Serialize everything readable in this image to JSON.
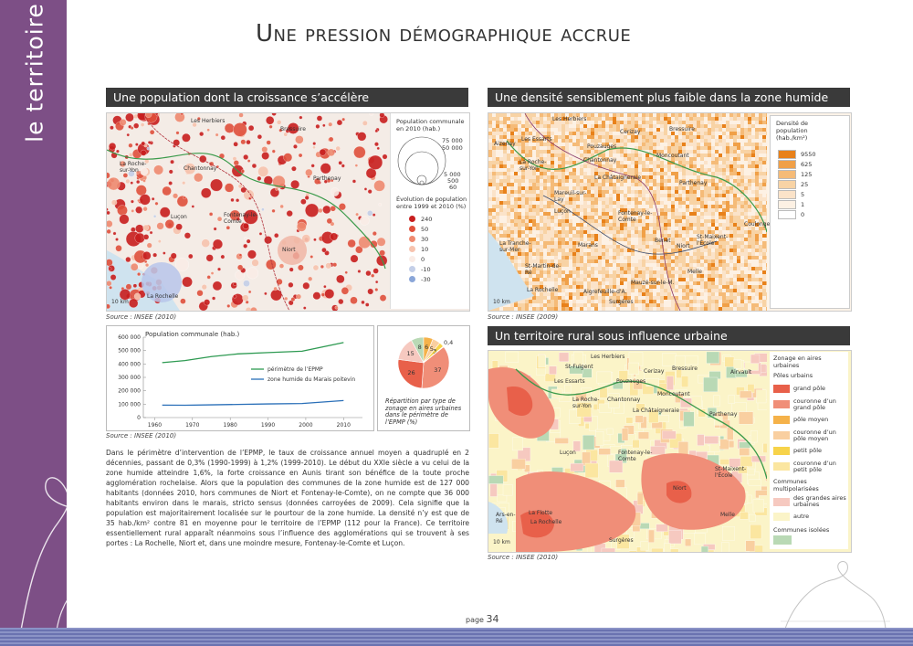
{
  "sidebar": {
    "title": "le territoire"
  },
  "page_title": "Une pression démographique accrue",
  "sections": {
    "pop_growth": "Une population dont la croissance s’accélère",
    "density": "Une densité sensiblement plus faible dans la zone humide",
    "rural": "Un territoire rural sous influence urbaine"
  },
  "map1": {
    "labels": [
      "Les Herbiers",
      "Bressuire",
      "La Roche-sur-Yon",
      "Chantonnay",
      "Parthenay",
      "Luçon",
      "Fontenay-le-Comte",
      "Niort",
      "La Rochelle"
    ],
    "scale": "10 km",
    "source": "Source : INSEE (2010)",
    "legend": {
      "size_title": "Population communale en 2010 (hab.)",
      "sizes": [
        "75 000",
        "50 000",
        "5 000",
        "500",
        "60"
      ],
      "evo_title": "Évolution de population entre 1999 et 2010 (%)",
      "evo": [
        {
          "label": "240",
          "color": "#c81e1e"
        },
        {
          "label": "50",
          "color": "#e0503c"
        },
        {
          "label": "30",
          "color": "#ef8a70"
        },
        {
          "label": "10",
          "color": "#f7c3ae"
        },
        {
          "label": "0",
          "color": "#faece6"
        },
        {
          "label": "-10",
          "color": "#c4cfe8"
        },
        {
          "label": "-30",
          "color": "#8aa6d8"
        }
      ]
    }
  },
  "map2": {
    "labels": [
      "Les Herbiers",
      "Cerizay",
      "Bressuire",
      "Aizenay",
      "Les Essarts",
      "Pouzauges",
      "La Roche-sur-Yon",
      "Chantonnay",
      "Moncoutant",
      "La Châtaigneraie",
      "Parthenay",
      "Mareuil-sur-Lay",
      "Luçon",
      "Fontenay-le-Comte",
      "Coulonges",
      "La Tranche-sur-Mer",
      "Marans",
      "Benet",
      "Niort",
      "St-Maixent-l'École",
      "St-Martin-de-Ré",
      "Mauzé-sur-le-M.",
      "Melle",
      "La Rochelle",
      "Aigrefeuille-d'A.",
      "Surgères"
    ],
    "scale": "10 km",
    "source": "Source : INSEE (2009)",
    "legend": {
      "title": "Densité de population (hab./km²)",
      "items": [
        {
          "label": "9550",
          "color": "#e8811a"
        },
        {
          "label": "625",
          "color": "#f0a048"
        },
        {
          "label": "125",
          "color": "#f5bb78"
        },
        {
          "label": "25",
          "color": "#f8d3a5"
        },
        {
          "label": "5",
          "color": "#fbe3c9"
        },
        {
          "label": "1",
          "color": "#fdf1e4"
        },
        {
          "label": "0",
          "color": "#ffffff"
        }
      ]
    }
  },
  "map3": {
    "labels": [
      "Les Herbiers",
      "St-Fulgent",
      "Cerizay",
      "Bressuire",
      "Airvault",
      "Les Essarts",
      "Pouzauges",
      "La Roche-sur-Yon",
      "Chantonnay",
      "Moncoutant",
      "La Châtaigneraie",
      "Parthenay",
      "Luçon",
      "Fontenay-le-Comte",
      "St-Maixent-l'École",
      "Niort",
      "La Flotte",
      "Ars-en-Ré",
      "La Rochelle",
      "Melle",
      "Surgères"
    ],
    "scale": "10 km",
    "source": "Source : INSEE (2010)",
    "legend": {
      "title": "Zonage en aires urbaines",
      "poles_title": "Pôles urbains",
      "items": [
        {
          "label": "grand pôle",
          "color": "#e8604a"
        },
        {
          "label": "couronne d’un grand pôle",
          "color": "#f08e78"
        },
        {
          "label": "pôle moyen",
          "color": "#f5b24a"
        },
        {
          "label": "couronne d’un pôle moyen",
          "color": "#f9cfa0"
        },
        {
          "label": "petit pôle",
          "color": "#f7d34a"
        },
        {
          "label": "couronne d’un petit pôle",
          "color": "#fbe6a0"
        }
      ],
      "multi_title": "Communes multipolarisées",
      "multi": [
        {
          "label": "des grandes aires urbaines",
          "color": "#f6c9c0"
        },
        {
          "label": "autre",
          "color": "#fbf4c8"
        }
      ],
      "isolated_title": "Communes isolées",
      "isolated_color": "#b9d9b5"
    }
  },
  "line_chart": {
    "title": "Population communale (hab.)",
    "source": "Source : INSEE (2010)"
  },
  "pie_chart": {
    "caption": "Répartition par type de zonage en aires urbaines dans le périmètre de l’EPMP (%)"
  },
  "chart_data": [
    {
      "type": "line",
      "title": "Population communale (hab.)",
      "x": [
        1962,
        1968,
        1975,
        1982,
        1990,
        1999,
        2010
      ],
      "xticks": [
        "1960",
        "1970",
        "1980",
        "1990",
        "2000",
        "2010"
      ],
      "yticks": [
        "0",
        "100 000",
        "200 000",
        "300 000",
        "400 000",
        "500 000",
        "600 000"
      ],
      "ylim": [
        0,
        600000
      ],
      "xlim": [
        1957,
        2015
      ],
      "series": [
        {
          "name": "périmètre de l’EPMP",
          "color": "#2e9a52",
          "values": [
            410000,
            425000,
            455000,
            475000,
            485000,
            495000,
            560000
          ]
        },
        {
          "name": "zone humide du Marais poitevin",
          "color": "#2a6fb8",
          "values": [
            93000,
            92000,
            95000,
            98000,
            102000,
            105000,
            127000
          ]
        }
      ]
    },
    {
      "type": "pie",
      "title": "Répartition par type de zonage en aires urbaines dans le périmètre de l’EPMP (%)",
      "slices": [
        {
          "label": "37",
          "value": 37,
          "color": "#f08e78"
        },
        {
          "label": "26",
          "value": 26,
          "color": "#e8604a"
        },
        {
          "label": "15",
          "value": 15,
          "color": "#f6c9c0"
        },
        {
          "label": "8",
          "value": 8,
          "color": "#b9d9b5"
        },
        {
          "label": "6",
          "value": 6,
          "color": "#f5b24a"
        },
        {
          "label": "5",
          "value": 5,
          "color": "#f9cfa0"
        },
        {
          "label": "3",
          "value": 3,
          "color": "#f7d34a"
        },
        {
          "label": "0,4",
          "value": 0.4,
          "color": "#fbe6a0"
        }
      ]
    }
  ],
  "body": "Dans le périmètre d’intervention de l’EPMP, le taux de croissance annuel moyen a quadruplé en 2 décennies, passant de 0,3% (1990-1999) à 1,2% (1999-2010). Le début du XXIe siècle a vu celui de la zone humide atteindre 1,6%, la forte croissance en Aunis tirant son bénéfice de la toute proche agglomération rochelaise. Alors que la population des communes de la zone humide est de 127 000 habitants (données 2010, hors communes de Niort et Fontenay-le-Comte), on ne compte que 36 000 habitants environ dans le marais, stricto sensus (données carroyées de 2009). Cela signifie que la population est majoritairement localisée sur le pourtour de la zone humide. La densité n’y est que de 35 hab./km² contre 81 en moyenne pour le territoire de l’EPMP (112 pour la France). Ce territoire essentiellement rural apparaît néanmoins sous l’influence des agglomérations qui se trouvent à ses portes : La Rochelle, Niort et, dans une moindre mesure, Fontenay-le-Comte et Luçon.",
  "page": {
    "prefix": "page",
    "number": "34"
  }
}
